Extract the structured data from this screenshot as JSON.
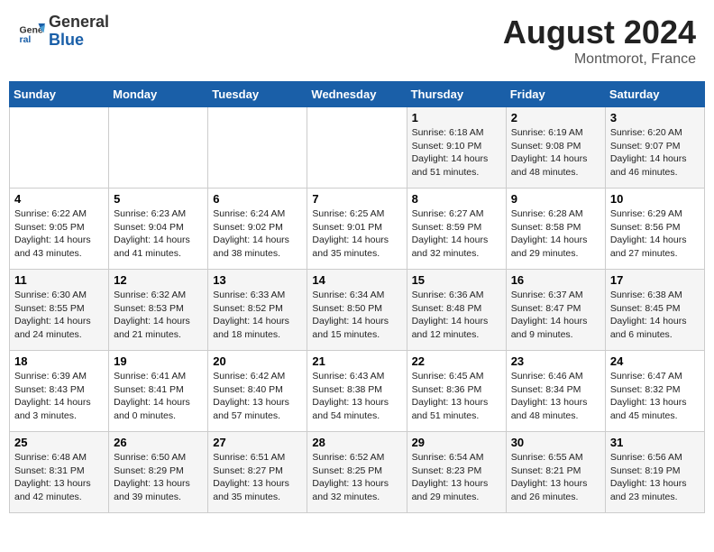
{
  "header": {
    "logo_general": "General",
    "logo_blue": "Blue",
    "month_year": "August 2024",
    "location": "Montmorot, France"
  },
  "days_of_week": [
    "Sunday",
    "Monday",
    "Tuesday",
    "Wednesday",
    "Thursday",
    "Friday",
    "Saturday"
  ],
  "weeks": [
    [
      {
        "day": "",
        "info": ""
      },
      {
        "day": "",
        "info": ""
      },
      {
        "day": "",
        "info": ""
      },
      {
        "day": "",
        "info": ""
      },
      {
        "day": "1",
        "info": "Sunrise: 6:18 AM\nSunset: 9:10 PM\nDaylight: 14 hours\nand 51 minutes."
      },
      {
        "day": "2",
        "info": "Sunrise: 6:19 AM\nSunset: 9:08 PM\nDaylight: 14 hours\nand 48 minutes."
      },
      {
        "day": "3",
        "info": "Sunrise: 6:20 AM\nSunset: 9:07 PM\nDaylight: 14 hours\nand 46 minutes."
      }
    ],
    [
      {
        "day": "4",
        "info": "Sunrise: 6:22 AM\nSunset: 9:05 PM\nDaylight: 14 hours\nand 43 minutes."
      },
      {
        "day": "5",
        "info": "Sunrise: 6:23 AM\nSunset: 9:04 PM\nDaylight: 14 hours\nand 41 minutes."
      },
      {
        "day": "6",
        "info": "Sunrise: 6:24 AM\nSunset: 9:02 PM\nDaylight: 14 hours\nand 38 minutes."
      },
      {
        "day": "7",
        "info": "Sunrise: 6:25 AM\nSunset: 9:01 PM\nDaylight: 14 hours\nand 35 minutes."
      },
      {
        "day": "8",
        "info": "Sunrise: 6:27 AM\nSunset: 8:59 PM\nDaylight: 14 hours\nand 32 minutes."
      },
      {
        "day": "9",
        "info": "Sunrise: 6:28 AM\nSunset: 8:58 PM\nDaylight: 14 hours\nand 29 minutes."
      },
      {
        "day": "10",
        "info": "Sunrise: 6:29 AM\nSunset: 8:56 PM\nDaylight: 14 hours\nand 27 minutes."
      }
    ],
    [
      {
        "day": "11",
        "info": "Sunrise: 6:30 AM\nSunset: 8:55 PM\nDaylight: 14 hours\nand 24 minutes."
      },
      {
        "day": "12",
        "info": "Sunrise: 6:32 AM\nSunset: 8:53 PM\nDaylight: 14 hours\nand 21 minutes."
      },
      {
        "day": "13",
        "info": "Sunrise: 6:33 AM\nSunset: 8:52 PM\nDaylight: 14 hours\nand 18 minutes."
      },
      {
        "day": "14",
        "info": "Sunrise: 6:34 AM\nSunset: 8:50 PM\nDaylight: 14 hours\nand 15 minutes."
      },
      {
        "day": "15",
        "info": "Sunrise: 6:36 AM\nSunset: 8:48 PM\nDaylight: 14 hours\nand 12 minutes."
      },
      {
        "day": "16",
        "info": "Sunrise: 6:37 AM\nSunset: 8:47 PM\nDaylight: 14 hours\nand 9 minutes."
      },
      {
        "day": "17",
        "info": "Sunrise: 6:38 AM\nSunset: 8:45 PM\nDaylight: 14 hours\nand 6 minutes."
      }
    ],
    [
      {
        "day": "18",
        "info": "Sunrise: 6:39 AM\nSunset: 8:43 PM\nDaylight: 14 hours\nand 3 minutes."
      },
      {
        "day": "19",
        "info": "Sunrise: 6:41 AM\nSunset: 8:41 PM\nDaylight: 14 hours\nand 0 minutes."
      },
      {
        "day": "20",
        "info": "Sunrise: 6:42 AM\nSunset: 8:40 PM\nDaylight: 13 hours\nand 57 minutes."
      },
      {
        "day": "21",
        "info": "Sunrise: 6:43 AM\nSunset: 8:38 PM\nDaylight: 13 hours\nand 54 minutes."
      },
      {
        "day": "22",
        "info": "Sunrise: 6:45 AM\nSunset: 8:36 PM\nDaylight: 13 hours\nand 51 minutes."
      },
      {
        "day": "23",
        "info": "Sunrise: 6:46 AM\nSunset: 8:34 PM\nDaylight: 13 hours\nand 48 minutes."
      },
      {
        "day": "24",
        "info": "Sunrise: 6:47 AM\nSunset: 8:32 PM\nDaylight: 13 hours\nand 45 minutes."
      }
    ],
    [
      {
        "day": "25",
        "info": "Sunrise: 6:48 AM\nSunset: 8:31 PM\nDaylight: 13 hours\nand 42 minutes."
      },
      {
        "day": "26",
        "info": "Sunrise: 6:50 AM\nSunset: 8:29 PM\nDaylight: 13 hours\nand 39 minutes."
      },
      {
        "day": "27",
        "info": "Sunrise: 6:51 AM\nSunset: 8:27 PM\nDaylight: 13 hours\nand 35 minutes."
      },
      {
        "day": "28",
        "info": "Sunrise: 6:52 AM\nSunset: 8:25 PM\nDaylight: 13 hours\nand 32 minutes."
      },
      {
        "day": "29",
        "info": "Sunrise: 6:54 AM\nSunset: 8:23 PM\nDaylight: 13 hours\nand 29 minutes."
      },
      {
        "day": "30",
        "info": "Sunrise: 6:55 AM\nSunset: 8:21 PM\nDaylight: 13 hours\nand 26 minutes."
      },
      {
        "day": "31",
        "info": "Sunrise: 6:56 AM\nSunset: 8:19 PM\nDaylight: 13 hours\nand 23 minutes."
      }
    ]
  ]
}
